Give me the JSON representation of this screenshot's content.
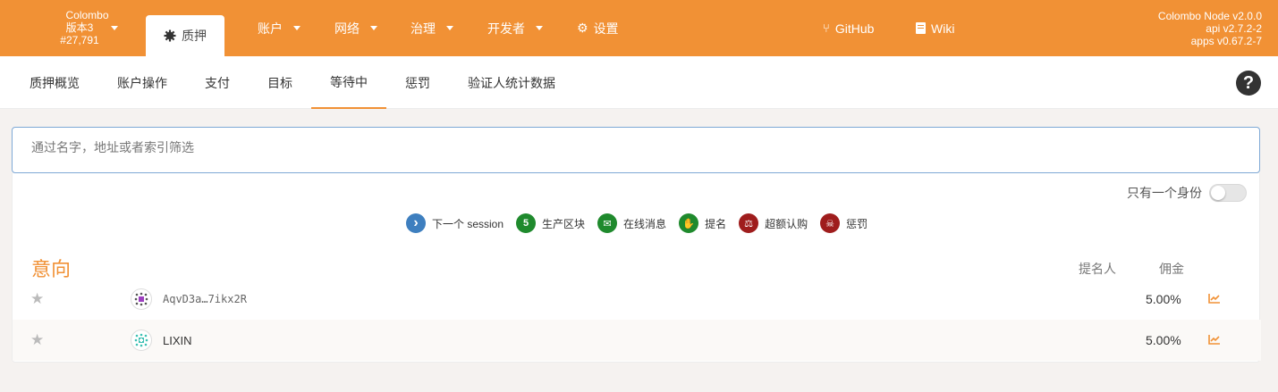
{
  "chain": {
    "name": "Colombo",
    "version": "版本3",
    "block": "#27,791"
  },
  "nav": {
    "staking": "质押",
    "accounts": "账户",
    "network": "网络",
    "governance": "治理",
    "developer": "开发者",
    "settings": "设置",
    "github": "GitHub",
    "wiki": "Wiki"
  },
  "node_info": {
    "node": "Colombo Node v2.0.0",
    "api": "api v2.7.2-2",
    "apps": "apps v0.67.2-7"
  },
  "subtabs": [
    "质押概览",
    "账户操作",
    "支付",
    "目标",
    "等待中",
    "惩罚",
    "验证人统计数据"
  ],
  "active_subtab": "等待中",
  "filter": {
    "placeholder": "通过名字，地址或者索引筛选"
  },
  "toggle": {
    "label": "只有一个身份"
  },
  "legend": [
    {
      "icon": "chevron-right-icon",
      "label": "下一个 session",
      "color": "#3e7fbf",
      "glyph": "›"
    },
    {
      "icon": "count-badge-icon",
      "label": "生产区块",
      "color": "#1f8a2d",
      "glyph": "5"
    },
    {
      "icon": "envelope-icon",
      "label": "在线消息",
      "color": "#1f8a2d",
      "glyph": "✉"
    },
    {
      "icon": "hand-icon",
      "label": "提名",
      "color": "#1f8a2d",
      "glyph": "✋"
    },
    {
      "icon": "scale-icon",
      "label": "超额认购",
      "color": "#9f1d1d",
      "glyph": "⚖"
    },
    {
      "icon": "skull-icon",
      "label": "惩罚",
      "color": "#9f1d1d",
      "glyph": "☠"
    }
  ],
  "section": {
    "title": "意向",
    "col_nominators": "提名人",
    "col_commission": "佣金"
  },
  "rows": [
    {
      "address": "AqvD3a…7ikx2R",
      "commission": "5.00%"
    },
    {
      "address": "LIXIN",
      "commission": "5.00%"
    }
  ],
  "colors": {
    "accent": "#f19135",
    "filter_border": "#7ea9d6"
  }
}
